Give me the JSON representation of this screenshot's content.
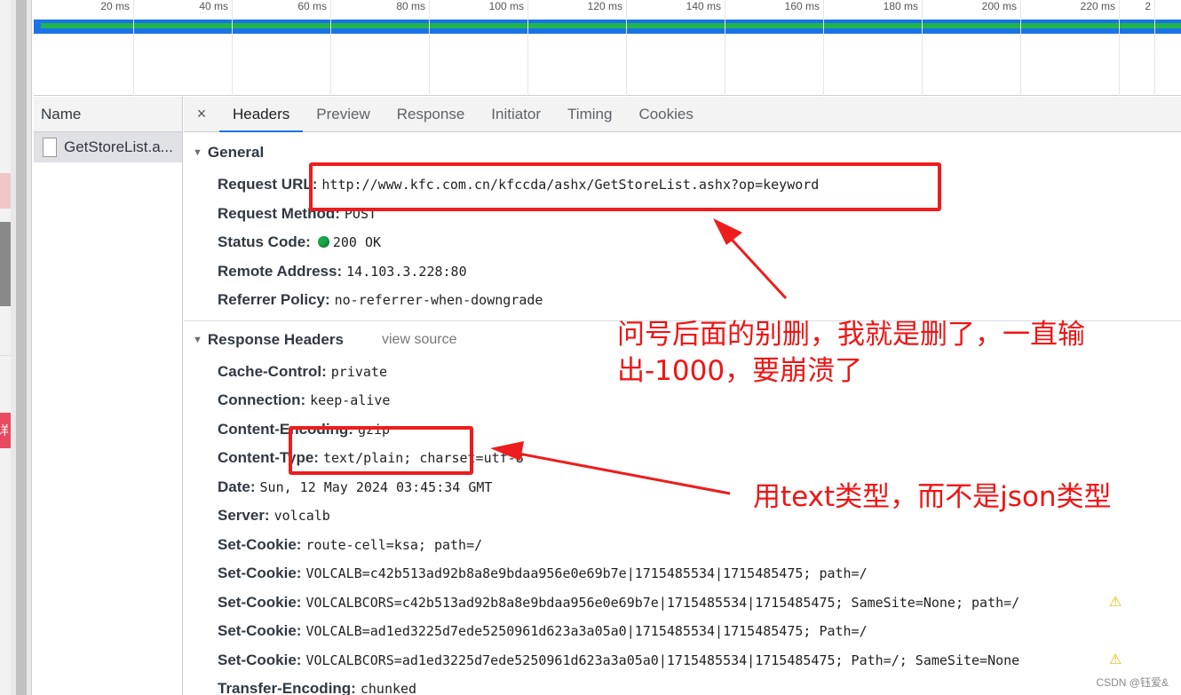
{
  "timeline": {
    "ticks": [
      "20 ms",
      "40 ms",
      "60 ms",
      "80 ms",
      "100 ms",
      "120 ms",
      "140 ms",
      "160 ms",
      "180 ms",
      "200 ms",
      "220 ms",
      "2"
    ]
  },
  "name_column": {
    "header": "Name",
    "rows": [
      "GetStoreList.a..."
    ]
  },
  "tabs": {
    "close": "×",
    "items": [
      "Headers",
      "Preview",
      "Response",
      "Initiator",
      "Timing",
      "Cookies"
    ],
    "active": "Headers"
  },
  "general": {
    "title": "General",
    "rows": [
      {
        "key": "Request URL:",
        "value": "http://www.kfc.com.cn/kfccda/ashx/GetStoreList.ashx?op=keyword"
      },
      {
        "key": "Request Method:",
        "value": "POST"
      },
      {
        "key": "Status Code:",
        "value": "200 OK"
      },
      {
        "key": "Remote Address:",
        "value": "14.103.3.228:80"
      },
      {
        "key": "Referrer Policy:",
        "value": "no-referrer-when-downgrade"
      }
    ]
  },
  "response_headers": {
    "title": "Response Headers",
    "view_source": "view source",
    "rows": [
      {
        "key": "Cache-Control:",
        "value": "private"
      },
      {
        "key": "Connection:",
        "value": "keep-alive"
      },
      {
        "key": "Content-Encoding:",
        "value": "gzip"
      },
      {
        "key": "Content-Type:",
        "value": "text/plain; charset=utf-8"
      },
      {
        "key": "Date:",
        "value": "Sun, 12 May 2024 03:45:34 GMT"
      },
      {
        "key": "Server:",
        "value": "volcalb"
      },
      {
        "key": "Set-Cookie:",
        "value": "route-cell=ksa; path=/"
      },
      {
        "key": "Set-Cookie:",
        "value": "VOLCALB=c42b513ad92b8a8e9bdaa956e0e69b7e|1715485534|1715485475; path=/"
      },
      {
        "key": "Set-Cookie:",
        "value": "VOLCALBCORS=c42b513ad92b8a8e9bdaa956e0e69b7e|1715485534|1715485475; SameSite=None; path=/"
      },
      {
        "key": "Set-Cookie:",
        "value": "VOLCALB=ad1ed3225d7ede5250961d623a3a05a0|1715485534|1715485475; Path=/"
      },
      {
        "key": "Set-Cookie:",
        "value": "VOLCALBCORS=ad1ed3225d7ede5250961d623a3a05a0|1715485534|1715485475; Path=/; SameSite=None"
      },
      {
        "key": "Transfer-Encoding:",
        "value": "chunked"
      }
    ],
    "warning_icon": "warning-triangle-icon"
  },
  "annotations": {
    "note1_line1": "问号后面的别删，我就是删了，一直输",
    "note1_line2": "出-1000，要崩溃了",
    "note2": "用text类型，而不是json类型",
    "color": "#ee1c1c"
  },
  "edge_glyph": "详",
  "watermark": "CSDN @钰爱&"
}
